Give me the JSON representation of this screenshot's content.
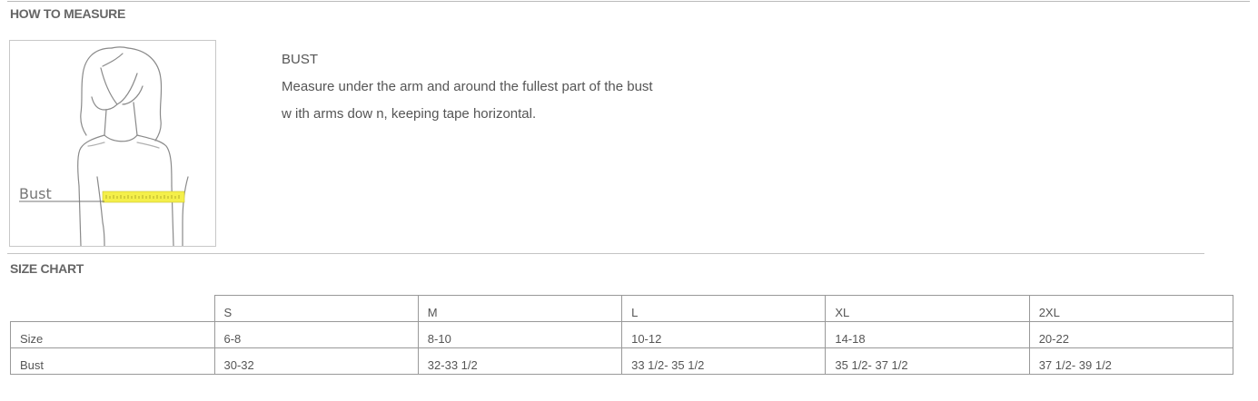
{
  "how_to_measure": {
    "title": "HOW TO MEASURE",
    "illustration": {
      "label": "Bust"
    },
    "measurement": {
      "name": "BUST",
      "line1": "Measure under the arm and around the fullest part of the bust",
      "line2": "w ith arms dow n, keeping tape horizontal."
    }
  },
  "size_chart": {
    "title": "SIZE CHART",
    "sizes": [
      "S",
      "M",
      "L",
      "XL",
      "2XL"
    ],
    "rows": [
      {
        "label": "Size",
        "values": [
          "6-8",
          "8-10",
          "10-12",
          "14-18",
          "20-22"
        ]
      },
      {
        "label": "Bust",
        "values": [
          "30-32",
          "32-33 1/2",
          "33 1/2- 35 1/2",
          "35 1/2- 37 1/2",
          "37 1/2- 39 1/2"
        ]
      }
    ]
  },
  "colors": {
    "tape": "#f4ef4a",
    "line": "#999999",
    "text": "#555555"
  }
}
